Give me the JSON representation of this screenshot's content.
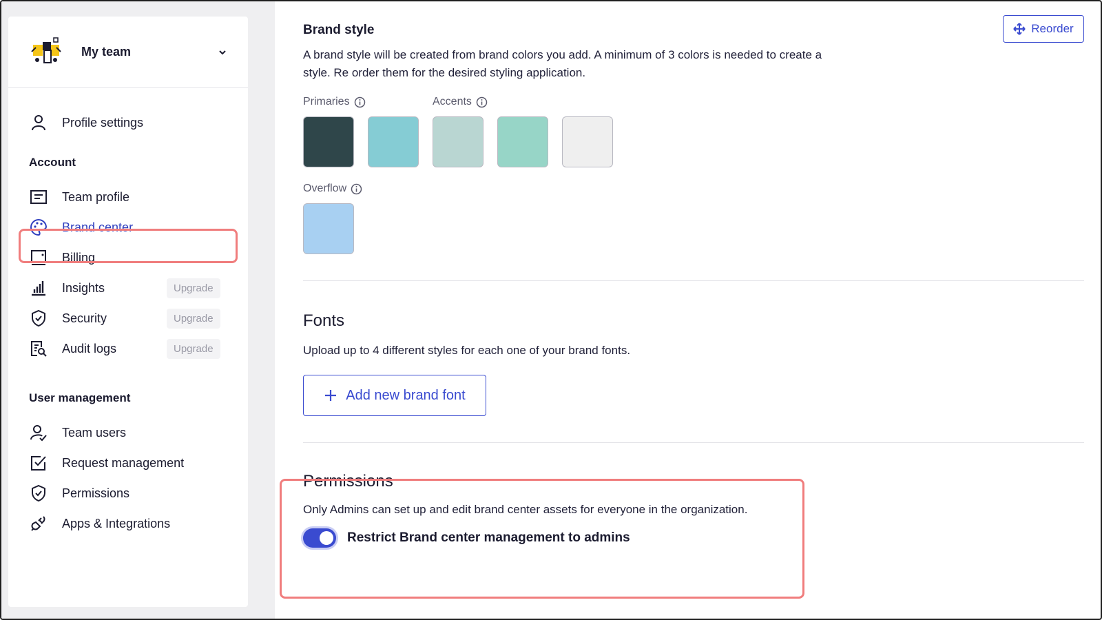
{
  "sidebar": {
    "team_name": "My team",
    "profile_settings": "Profile settings",
    "account_heading": "Account",
    "account_items": [
      {
        "label": "Team profile",
        "icon": "id-card-icon"
      },
      {
        "label": "Brand center",
        "icon": "palette-icon",
        "active": true
      },
      {
        "label": "Billing",
        "icon": "billing-icon"
      },
      {
        "label": "Insights",
        "icon": "chart-bars-icon",
        "badge": "Upgrade"
      },
      {
        "label": "Security",
        "icon": "shield-check-icon",
        "badge": "Upgrade"
      },
      {
        "label": "Audit logs",
        "icon": "document-search-icon",
        "badge": "Upgrade"
      }
    ],
    "user_mgmt_heading": "User management",
    "user_items": [
      {
        "label": "Team users",
        "icon": "user-check-icon"
      },
      {
        "label": "Request management",
        "icon": "checkbox-icon"
      },
      {
        "label": "Permissions",
        "icon": "shield-check-icon"
      },
      {
        "label": "Apps & Integrations",
        "icon": "plug-icon"
      }
    ]
  },
  "brand_style": {
    "title": "Brand style",
    "reorder_label": "Reorder",
    "description": "A brand style will be created from brand colors you add. A minimum of 3 colors is needed to create a style. Re order them for the desired styling application.",
    "primaries_label": "Primaries",
    "accents_label": "Accents",
    "overflow_label": "Overflow",
    "primary_colors": [
      "#2f464a",
      "#85ccd4"
    ],
    "accent_colors": [
      "#b9d6d2",
      "#97d5c7",
      "#efefef"
    ],
    "overflow_colors": [
      "#a8d0f2"
    ]
  },
  "fonts": {
    "title": "Fonts",
    "description": "Upload up to 4 different styles for each one of your brand fonts.",
    "add_label": "Add new brand font"
  },
  "permissions": {
    "title": "Permissions",
    "description": "Only Admins can set up and edit brand center assets for everyone in the organization.",
    "toggle_label": "Restrict Brand center management to admins",
    "toggle_on": true
  },
  "colors": {
    "accent": "#3a4bd0",
    "highlight": "#f07d7d"
  }
}
